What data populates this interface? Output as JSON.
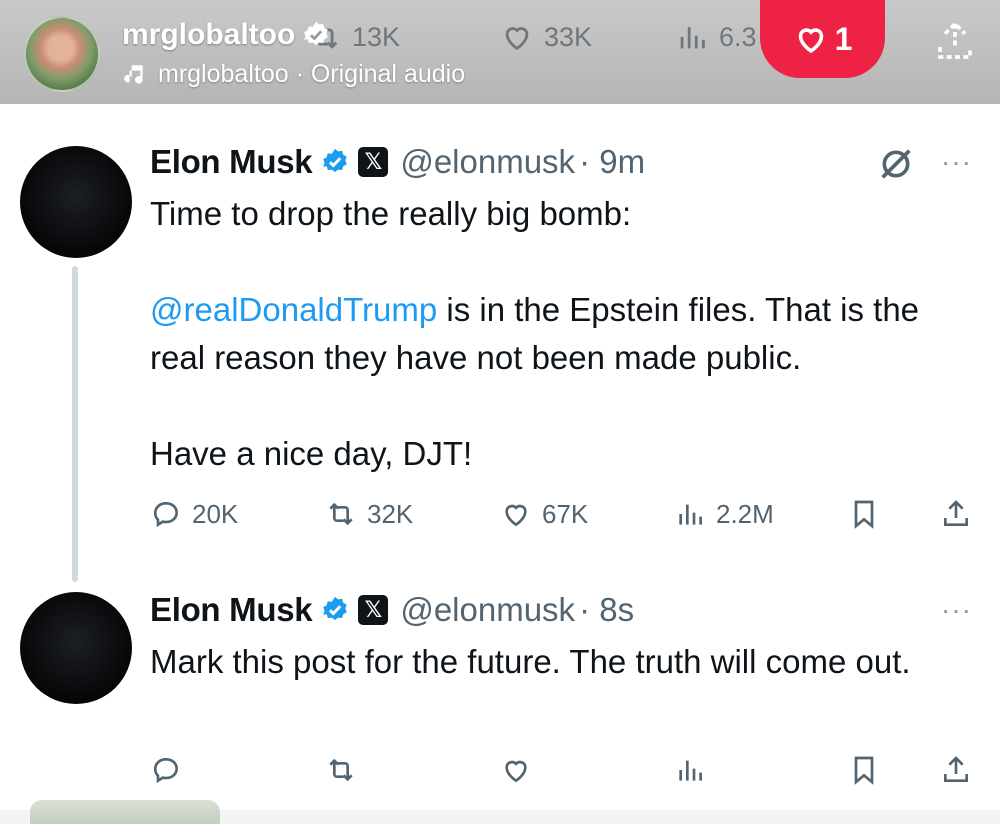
{
  "reel": {
    "username": "mrglobaltoo",
    "audio_label": "mrglobaltoo · Original audio",
    "like_count": "1",
    "accent_color": "#ee2245",
    "ghost_stats": {
      "retweets": "13K",
      "likes": "33K",
      "views": "6.3"
    }
  },
  "tweets": [
    {
      "name": "Elon Musk",
      "handle": "@elonmusk",
      "time": "· 9m",
      "text_line1": "Time to drop the really big bomb:",
      "mention": "@realDonaldTrump",
      "text_line2_rest": " is in the Epstein files. That is the real reason they have not been made public.",
      "text_line3": "Have a nice day, DJT!",
      "replies": "20K",
      "retweets": "32K",
      "likes": "67K",
      "views": "2.2M",
      "menu": "···"
    },
    {
      "name": "Elon Musk",
      "handle": "@elonmusk",
      "time": "· 8s",
      "text": "Mark this post for the future. The truth will come out.",
      "menu": "···"
    }
  ],
  "icons": [
    "reply-icon",
    "retweet-icon",
    "like-icon",
    "views-icon",
    "bookmark-icon",
    "share-icon",
    "verified-icon",
    "x-logo-icon",
    "grok-icon",
    "music-note-icon",
    "heart-icon"
  ],
  "colors": {
    "mention": "#1d9bf0",
    "verified": "#1d9bf0",
    "muted": "#536471"
  }
}
